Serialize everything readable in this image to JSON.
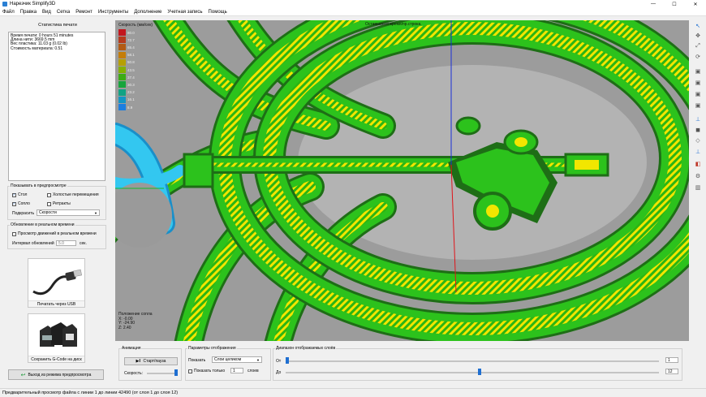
{
  "window": {
    "title": "Нарезчик Simplify3D",
    "minimize": "—",
    "maximize": "☐",
    "close": "✕"
  },
  "menu": [
    "Файл",
    "Правка",
    "Вид",
    "Сетка",
    "Ремонт",
    "Инструменты",
    "Дополнение",
    "Учетная запись",
    "Помощь"
  ],
  "stats": {
    "title": "Статистика печати",
    "lines": [
      "Время печати: 0 hours 51 minutes",
      "Длина нити: 3669.5 mm",
      "Вес пластика: 11.03 g (0.02 lb)",
      "Стоимость материала: 0.51"
    ]
  },
  "preview": {
    "title": "Показывать в предпросмотре",
    "table": "Стол",
    "travel": "Холостые перемещения",
    "nozzle": "Сопло",
    "retracts": "Ретракты",
    "highlight_label": "Подкрасить",
    "highlight_value": "Скорости"
  },
  "realtime": {
    "title": "Обновление в реальном времени",
    "view_moves": "Просмотр движений в реальном времени",
    "interval_label": "Интервал обновлений",
    "interval_value": "5.0",
    "interval_unit": "сек."
  },
  "cards": {
    "usb": "Печатать через USB",
    "sd": "Сохранить G-Code на диск"
  },
  "exit_button": "Выход из режима предпросмотра",
  "viewport": {
    "legend_title": "Скорость (мм/сек)",
    "legend": [
      {
        "label": "80.0",
        "color": "#c3161e"
      },
      {
        "label": "72.7",
        "color": "#b63a1d"
      },
      {
        "label": "65.4",
        "color": "#b25a13"
      },
      {
        "label": "58.1",
        "color": "#c47d0a"
      },
      {
        "label": "50.8",
        "color": "#b6a000"
      },
      {
        "label": "43.5",
        "color": "#85b000"
      },
      {
        "label": "37.4",
        "color": "#3cac14"
      },
      {
        "label": "30.3",
        "color": "#17a53c"
      },
      {
        "label": "23.2",
        "color": "#11a384"
      },
      {
        "label": "16.1",
        "color": "#1496c4"
      },
      {
        "label": "8.9",
        "color": "#1c7ee0"
      }
    ],
    "overlay_top": "Оставшееся время/пр.строка.",
    "position_title": "Положение сопла",
    "pos_x": "X: -0.00",
    "pos_y": "Y: -24.90",
    "pos_z": "Z: 2.40"
  },
  "tools": [
    "select-tool",
    "move-tool",
    "scale-tool",
    "rotate-tool",
    "view-front",
    "view-top",
    "view-side",
    "view-iso",
    "axes-tool",
    "solid-view",
    "wireframe-view",
    "origin-tool",
    "cross-section",
    "settings-tool",
    "layers-tool"
  ],
  "animation": {
    "title": "Анимация",
    "play": "Старт/пауза",
    "speed_label": "Скорость:",
    "speed": 0.95
  },
  "display": {
    "title": "Параметры отображения",
    "show_label": "Показать",
    "show_value": "Слои целиком",
    "only_label": "Показать только",
    "only_value": "1",
    "only_unit": "слоев"
  },
  "layers": {
    "title": "Диапазон отображаемых слоёв",
    "from_label": "От",
    "from_value": "1",
    "to_label": "До",
    "to_value": "12",
    "from_pos": 0.0,
    "to_pos": 0.52
  },
  "status": "Предварительный просмотр файла с линии 1 до линии 42490 (от слоя 1 до слоя 12)"
}
